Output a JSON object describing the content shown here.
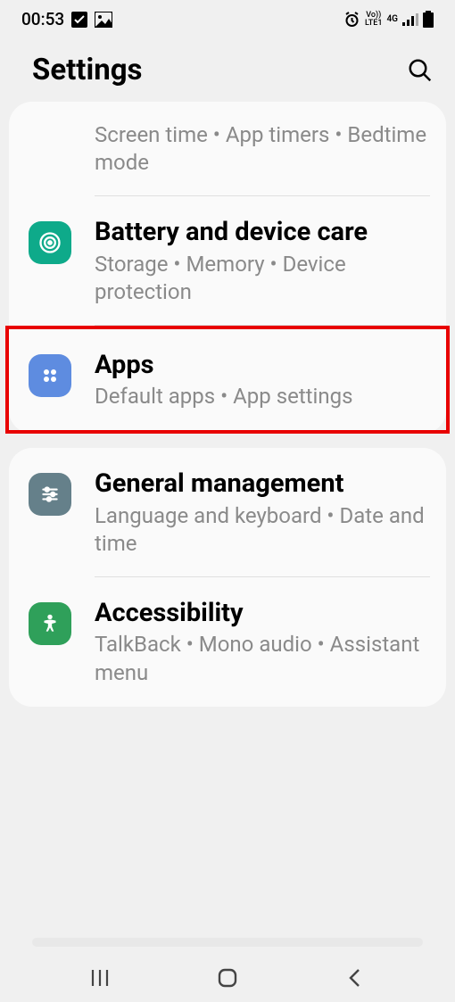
{
  "status": {
    "time": "00:53",
    "network": "LTE1",
    "volte": "Vo))",
    "signal": "4G"
  },
  "header": {
    "title": "Settings"
  },
  "card1": {
    "item0": {
      "subtitle": "Screen time  •  App timers  •  Bedtime mode"
    },
    "item1": {
      "title": "Battery and device care",
      "subtitle": "Storage  •  Memory  •  Device protection"
    },
    "item2": {
      "title": "Apps",
      "subtitle": "Default apps  •  App settings"
    }
  },
  "card2": {
    "item0": {
      "title": "General management",
      "subtitle": "Language and keyboard  •  Date and time"
    },
    "item1": {
      "title": "Accessibility",
      "subtitle": "TalkBack  •  Mono audio  •  Assistant menu"
    }
  }
}
